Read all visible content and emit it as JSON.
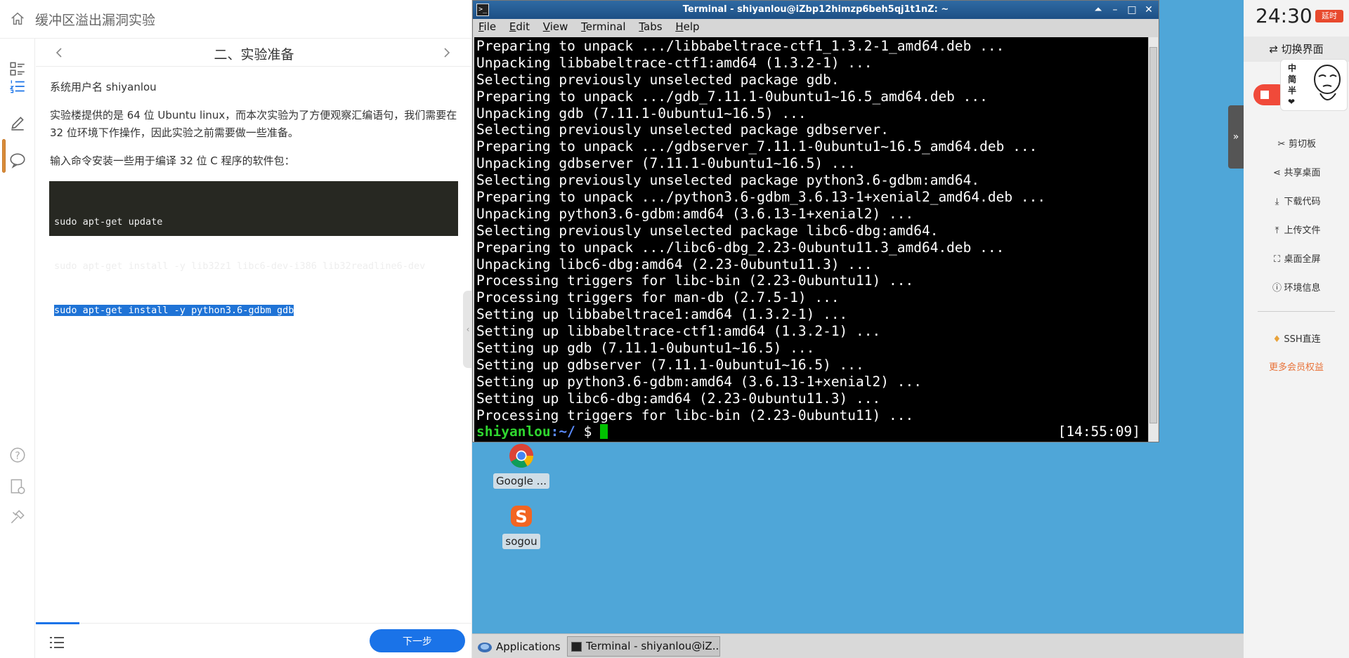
{
  "lab": {
    "title": "缓冲区溢出漏洞实验",
    "section_title": "二、实验准备",
    "paragraphs": [
      "系统用户名 shiyanlou",
      "实验楼提供的是 64 位 Ubuntu linux，而本次实验为了方便观察汇编语句，我们需要在 32 位环境下作操作，因此实验之前需要做一些准备。",
      "输入命令安装一些用于编译 32 位 C 程序的软件包："
    ],
    "code_lines": [
      "sudo apt-get update",
      "sudo apt-get install -y lib32z1 libc6-dev-i386 lib32readline6-dev",
      "sudo apt-get install -y python3.6-gdbm gdb"
    ],
    "next_button": "下一步"
  },
  "terminal": {
    "window_title": "Terminal - shiyanlou@iZbp12himzp6beh5qj1t1nZ: ~",
    "menu": [
      {
        "key": "F",
        "rest": "ile"
      },
      {
        "key": "E",
        "rest": "dit"
      },
      {
        "key": "V",
        "rest": "iew"
      },
      {
        "key": "T",
        "rest": "erminal"
      },
      {
        "key": "T",
        "rest": "abs"
      },
      {
        "key": "H",
        "rest": "elp"
      }
    ],
    "lines": [
      "Preparing to unpack .../libbabeltrace-ctf1_1.3.2-1_amd64.deb ...",
      "Unpacking libbabeltrace-ctf1:amd64 (1.3.2-1) ...",
      "Selecting previously unselected package gdb.",
      "Preparing to unpack .../gdb_7.11.1-0ubuntu1~16.5_amd64.deb ...",
      "Unpacking gdb (7.11.1-0ubuntu1~16.5) ...",
      "Selecting previously unselected package gdbserver.",
      "Preparing to unpack .../gdbserver_7.11.1-0ubuntu1~16.5_amd64.deb ...",
      "Unpacking gdbserver (7.11.1-0ubuntu1~16.5) ...",
      "Selecting previously unselected package python3.6-gdbm:amd64.",
      "Preparing to unpack .../python3.6-gdbm_3.6.13-1+xenial2_amd64.deb ...",
      "Unpacking python3.6-gdbm:amd64 (3.6.13-1+xenial2) ...",
      "Selecting previously unselected package libc6-dbg:amd64.",
      "Preparing to unpack .../libc6-dbg_2.23-0ubuntu11.3_amd64.deb ...",
      "Unpacking libc6-dbg:amd64 (2.23-0ubuntu11.3) ...",
      "Processing triggers for libc-bin (2.23-0ubuntu11) ...",
      "Processing triggers for man-db (2.7.5-1) ...",
      "Setting up libbabeltrace1:amd64 (1.3.2-1) ...",
      "Setting up libbabeltrace-ctf1:amd64 (1.3.2-1) ...",
      "Setting up gdb (7.11.1-0ubuntu1~16.5) ...",
      "Setting up gdbserver (7.11.1-0ubuntu1~16.5) ...",
      "Setting up python3.6-gdbm:amd64 (3.6.13-1+xenial2) ...",
      "Setting up libc6-dbg:amd64 (2.23-0ubuntu11.3) ...",
      "Processing triggers for libc-bin (2.23-0ubuntu11) ..."
    ],
    "prompt_user": "shiyanlou",
    "prompt_path": ":~/",
    "prompt_symbol": " $ ",
    "clock": "[14:55:09]"
  },
  "desktop": {
    "icons": [
      {
        "label": "Google ..."
      },
      {
        "label": "sogou"
      }
    ],
    "taskbar": {
      "apps_label": "Applications",
      "task_label": "Terminal - shiyanlou@iZ..."
    }
  },
  "sidebar": {
    "timer": "24:30",
    "extend": "延时",
    "switch_view": "切换界面",
    "promo_lines": [
      "中",
      "简",
      "半"
    ],
    "items": [
      {
        "label": "剪切板",
        "icon": "scissors-icon"
      },
      {
        "label": "共享桌面",
        "icon": "share-icon"
      },
      {
        "label": "下载代码",
        "icon": "download-icon"
      },
      {
        "label": "上传文件",
        "icon": "upload-icon"
      },
      {
        "label": "桌面全屏",
        "icon": "fullscreen-icon"
      },
      {
        "label": "环境信息",
        "icon": "info-icon"
      }
    ],
    "ssh_label": "SSH直连",
    "more_label": "更多会员权益"
  },
  "colors": {
    "accent_blue": "#1a73e8",
    "desktop_bg": "#4fa6d8",
    "prompt_green": "#2fd62f",
    "promo_orange": "#e8733a"
  }
}
